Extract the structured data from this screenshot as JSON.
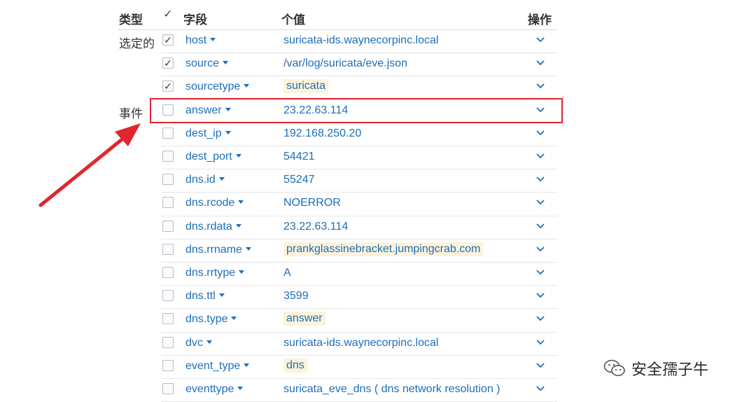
{
  "header": {
    "type": "类型",
    "field": "字段",
    "value": "个值",
    "actions": "操作",
    "select_all": "✓"
  },
  "groups": {
    "selected": "选定的",
    "event": "事件"
  },
  "rows": [
    {
      "field": "host",
      "value": "suricata-ids.waynecorpinc.local",
      "checked": true,
      "highlight": false
    },
    {
      "field": "source",
      "value": "/var/log/suricata/eve.json",
      "checked": true,
      "highlight": false
    },
    {
      "field": "sourcetype",
      "value": "suricata",
      "checked": true,
      "highlight": true
    },
    {
      "field": "answer",
      "value": "23.22.63.114",
      "checked": false,
      "highlight": false
    },
    {
      "field": "dest_ip",
      "value": "192.168.250.20",
      "checked": false,
      "highlight": false
    },
    {
      "field": "dest_port",
      "value": "54421",
      "checked": false,
      "highlight": false
    },
    {
      "field": "dns.id",
      "value": "55247",
      "checked": false,
      "highlight": false
    },
    {
      "field": "dns.rcode",
      "value": "NOERROR",
      "checked": false,
      "highlight": false
    },
    {
      "field": "dns.rdata",
      "value": "23.22.63.114",
      "checked": false,
      "highlight": false
    },
    {
      "field": "dns.rrname",
      "value": "prankglassinebracket.jumpingcrab.com",
      "checked": false,
      "highlight": true
    },
    {
      "field": "dns.rrtype",
      "value": "A",
      "checked": false,
      "highlight": false
    },
    {
      "field": "dns.ttl",
      "value": "3599",
      "checked": false,
      "highlight": false
    },
    {
      "field": "dns.type",
      "value": "answer",
      "checked": false,
      "highlight": true
    },
    {
      "field": "dvc",
      "value": "suricata-ids.waynecorpinc.local",
      "checked": false,
      "highlight": false
    },
    {
      "field": "event_type",
      "value": "dns",
      "checked": false,
      "highlight": true
    },
    {
      "field": "eventtype",
      "value": "suricata_eve_dns ( dns  network  resolution )",
      "checked": false,
      "highlight": false
    }
  ],
  "checkmark": "✓",
  "watermark": {
    "text": "安全孺子牛",
    "icon": "wechat-icon"
  },
  "annotation": {
    "box_color": "#e0262f",
    "arrow_color": "#e0262f"
  },
  "colors": {
    "link": "#1d6fb8",
    "highlight_bg": "#fdf3da"
  }
}
